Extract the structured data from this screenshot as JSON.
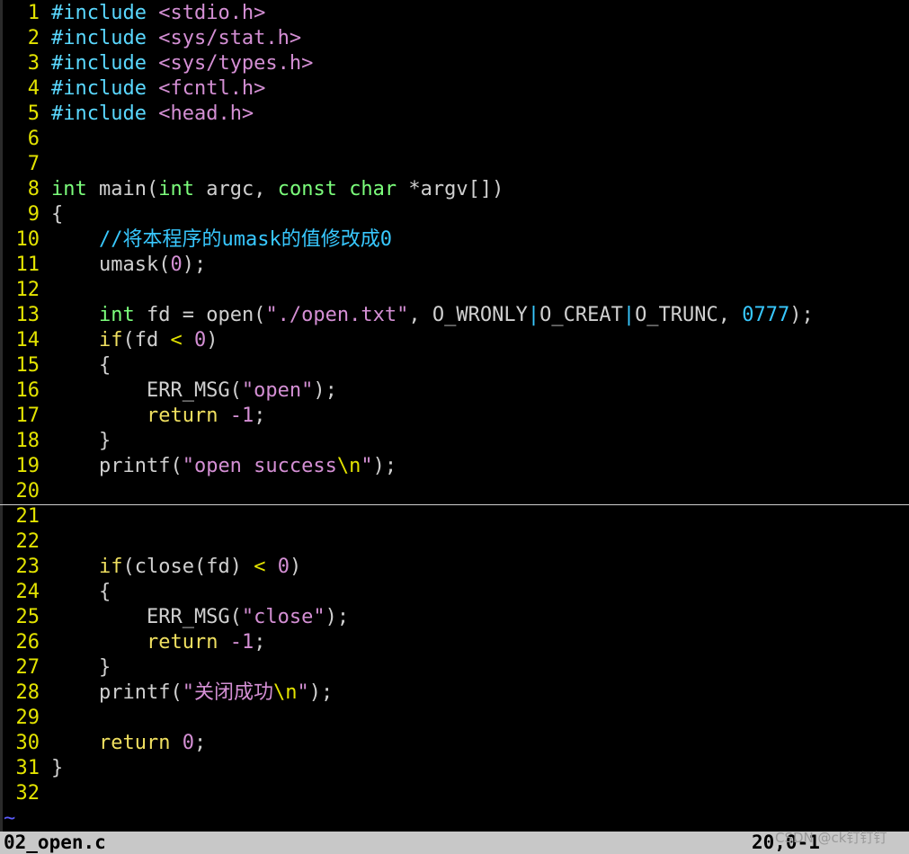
{
  "palette": {
    "background": "#000000",
    "line_number": "#e3e300",
    "preproc": "#5ad8ff",
    "header": "#d48fd4",
    "type": "#7cff7c",
    "keyword": "#f0e060",
    "comment": "#38c8ff",
    "string": "#d48fd4",
    "number": "#d48fd4",
    "operator": "#e3e300",
    "default": "#d0d0d0",
    "status_bg": "#c8c8c8",
    "eob_tilde": "#5c5cff"
  },
  "editor": {
    "cursor_line": 20,
    "lines": [
      {
        "n": "1",
        "tokens": [
          {
            "t": "#include",
            "k": "preproc"
          },
          {
            "t": " ",
            "k": "default"
          },
          {
            "t": "<stdio.h>",
            "k": "header"
          }
        ]
      },
      {
        "n": "2",
        "tokens": [
          {
            "t": "#include",
            "k": "preproc"
          },
          {
            "t": " ",
            "k": "default"
          },
          {
            "t": "<sys/stat.h>",
            "k": "header"
          }
        ]
      },
      {
        "n": "3",
        "tokens": [
          {
            "t": "#include",
            "k": "preproc"
          },
          {
            "t": " ",
            "k": "default"
          },
          {
            "t": "<sys/types.h>",
            "k": "header"
          }
        ]
      },
      {
        "n": "4",
        "tokens": [
          {
            "t": "#include",
            "k": "preproc"
          },
          {
            "t": " ",
            "k": "default"
          },
          {
            "t": "<fcntl.h>",
            "k": "header"
          }
        ]
      },
      {
        "n": "5",
        "tokens": [
          {
            "t": "#include",
            "k": "preproc"
          },
          {
            "t": " ",
            "k": "default"
          },
          {
            "t": "<head.h>",
            "k": "header"
          }
        ]
      },
      {
        "n": "6",
        "tokens": []
      },
      {
        "n": "7",
        "tokens": []
      },
      {
        "n": "8",
        "tokens": [
          {
            "t": "int",
            "k": "type"
          },
          {
            "t": " main(",
            "k": "default"
          },
          {
            "t": "int",
            "k": "type"
          },
          {
            "t": " argc, ",
            "k": "default"
          },
          {
            "t": "const",
            "k": "type"
          },
          {
            "t": " ",
            "k": "default"
          },
          {
            "t": "char",
            "k": "type"
          },
          {
            "t": " *argv[])",
            "k": "default"
          }
        ]
      },
      {
        "n": "9",
        "tokens": [
          {
            "t": "{",
            "k": "default"
          }
        ]
      },
      {
        "n": "10",
        "tokens": [
          {
            "t": "    ",
            "k": "default"
          },
          {
            "t": "//将本程序的umask的值修改成0",
            "k": "comment"
          }
        ]
      },
      {
        "n": "11",
        "tokens": [
          {
            "t": "    umask(",
            "k": "default"
          },
          {
            "t": "0",
            "k": "number"
          },
          {
            "t": ");",
            "k": "default"
          }
        ]
      },
      {
        "n": "12",
        "tokens": []
      },
      {
        "n": "13",
        "tokens": [
          {
            "t": "    ",
            "k": "default"
          },
          {
            "t": "int",
            "k": "type"
          },
          {
            "t": " fd = open(",
            "k": "default"
          },
          {
            "t": "\"./open.txt\"",
            "k": "string"
          },
          {
            "t": ", O_WRONLY",
            "k": "default"
          },
          {
            "t": "|",
            "k": "comment"
          },
          {
            "t": "O_CREAT",
            "k": "default"
          },
          {
            "t": "|",
            "k": "comment"
          },
          {
            "t": "O_TRUNC, ",
            "k": "default"
          },
          {
            "t": "0777",
            "k": "comment"
          },
          {
            "t": ");",
            "k": "default"
          }
        ]
      },
      {
        "n": "14",
        "tokens": [
          {
            "t": "    ",
            "k": "default"
          },
          {
            "t": "if",
            "k": "keyword"
          },
          {
            "t": "(fd ",
            "k": "default"
          },
          {
            "t": "<",
            "k": "operator"
          },
          {
            "t": " ",
            "k": "default"
          },
          {
            "t": "0",
            "k": "number"
          },
          {
            "t": ")",
            "k": "default"
          }
        ]
      },
      {
        "n": "15",
        "tokens": [
          {
            "t": "    {",
            "k": "default"
          }
        ]
      },
      {
        "n": "16",
        "tokens": [
          {
            "t": "        ERR_MSG(",
            "k": "default"
          },
          {
            "t": "\"open\"",
            "k": "string"
          },
          {
            "t": ");",
            "k": "default"
          }
        ]
      },
      {
        "n": "17",
        "tokens": [
          {
            "t": "        ",
            "k": "default"
          },
          {
            "t": "return",
            "k": "keyword"
          },
          {
            "t": " ",
            "k": "default"
          },
          {
            "t": "-1",
            "k": "number"
          },
          {
            "t": ";",
            "k": "default"
          }
        ]
      },
      {
        "n": "18",
        "tokens": [
          {
            "t": "    }",
            "k": "default"
          }
        ]
      },
      {
        "n": "19",
        "tokens": [
          {
            "t": "    printf(",
            "k": "default"
          },
          {
            "t": "\"open success",
            "k": "string"
          },
          {
            "t": "\\n",
            "k": "operator"
          },
          {
            "t": "\"",
            "k": "string"
          },
          {
            "t": ");",
            "k": "default"
          }
        ]
      },
      {
        "n": "20",
        "tokens": []
      },
      {
        "n": "21",
        "tokens": []
      },
      {
        "n": "22",
        "tokens": []
      },
      {
        "n": "23",
        "tokens": [
          {
            "t": "    ",
            "k": "default"
          },
          {
            "t": "if",
            "k": "keyword"
          },
          {
            "t": "(close(fd) ",
            "k": "default"
          },
          {
            "t": "<",
            "k": "operator"
          },
          {
            "t": " ",
            "k": "default"
          },
          {
            "t": "0",
            "k": "number"
          },
          {
            "t": ")",
            "k": "default"
          }
        ]
      },
      {
        "n": "24",
        "tokens": [
          {
            "t": "    {",
            "k": "default"
          }
        ]
      },
      {
        "n": "25",
        "tokens": [
          {
            "t": "        ERR_MSG(",
            "k": "default"
          },
          {
            "t": "\"close\"",
            "k": "string"
          },
          {
            "t": ");",
            "k": "default"
          }
        ]
      },
      {
        "n": "26",
        "tokens": [
          {
            "t": "        ",
            "k": "default"
          },
          {
            "t": "return",
            "k": "keyword"
          },
          {
            "t": " ",
            "k": "default"
          },
          {
            "t": "-1",
            "k": "number"
          },
          {
            "t": ";",
            "k": "default"
          }
        ]
      },
      {
        "n": "27",
        "tokens": [
          {
            "t": "    }",
            "k": "default"
          }
        ]
      },
      {
        "n": "28",
        "tokens": [
          {
            "t": "    printf(",
            "k": "default"
          },
          {
            "t": "\"关闭成功",
            "k": "string"
          },
          {
            "t": "\\n",
            "k": "operator"
          },
          {
            "t": "\"",
            "k": "string"
          },
          {
            "t": ");",
            "k": "default"
          }
        ]
      },
      {
        "n": "29",
        "tokens": []
      },
      {
        "n": "30",
        "tokens": [
          {
            "t": "    ",
            "k": "default"
          },
          {
            "t": "return",
            "k": "keyword"
          },
          {
            "t": " ",
            "k": "default"
          },
          {
            "t": "0",
            "k": "number"
          },
          {
            "t": ";",
            "k": "default"
          }
        ]
      },
      {
        "n": "31",
        "tokens": [
          {
            "t": "}",
            "k": "default"
          }
        ]
      },
      {
        "n": "32",
        "tokens": []
      }
    ],
    "eob_marker": "~"
  },
  "statusbar": {
    "filename": "02_open.c",
    "position": "20,0-1"
  },
  "watermark": "CSDN @ck钉钉钉"
}
